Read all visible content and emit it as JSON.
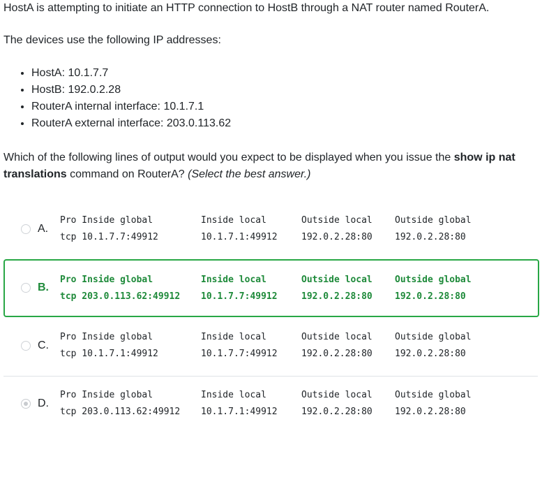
{
  "intro": "HostA is attempting to initiate an HTTP connection to HostB through a NAT router named RouterA.",
  "ip_intro": "The devices use the following IP addresses:",
  "ip_list": [
    "HostA: 10.1.7.7",
    "HostB: 192.0.2.28",
    "RouterA internal interface: 10.1.7.1",
    "RouterA external interface: 203.0.113.62"
  ],
  "question": {
    "before": "Which of the following lines of output would you expect to be displayed when you issue the ",
    "command": "show ip nat translations",
    "after": " command on RouterA?  ",
    "hint": "(Select the best answer.)"
  },
  "options": [
    {
      "letter": "A.",
      "header": [
        "Pro Inside global",
        "Inside local",
        "Outside local",
        "Outside global"
      ],
      "values": [
        "tcp 10.1.7.7:49912",
        "10.1.7.1:49912",
        "192.0.2.28:80",
        "192.0.2.28:80"
      ],
      "selected": false
    },
    {
      "letter": "B.",
      "header": [
        "Pro Inside global",
        "Inside local",
        "Outside local",
        "Outside global"
      ],
      "values": [
        "tcp 203.0.113.62:49912",
        "10.1.7.7:49912",
        "192.0.2.28:80",
        "192.0.2.28:80"
      ],
      "selected": true
    },
    {
      "letter": "C.",
      "header": [
        "Pro Inside global",
        "Inside local",
        "Outside local",
        "Outside global"
      ],
      "values": [
        "tcp 10.1.7.1:49912",
        "10.1.7.7:49912",
        "192.0.2.28:80",
        "192.0.2.28:80"
      ],
      "selected": false
    },
    {
      "letter": "D.",
      "header": [
        "Pro Inside global",
        "Inside local",
        "Outside local",
        "Outside global"
      ],
      "values": [
        "tcp 203.0.113.62:49912",
        "10.1.7.1:49912",
        "192.0.2.28:80",
        "192.0.2.28:80"
      ],
      "selected": false,
      "radio_checked_disabled": true
    }
  ]
}
